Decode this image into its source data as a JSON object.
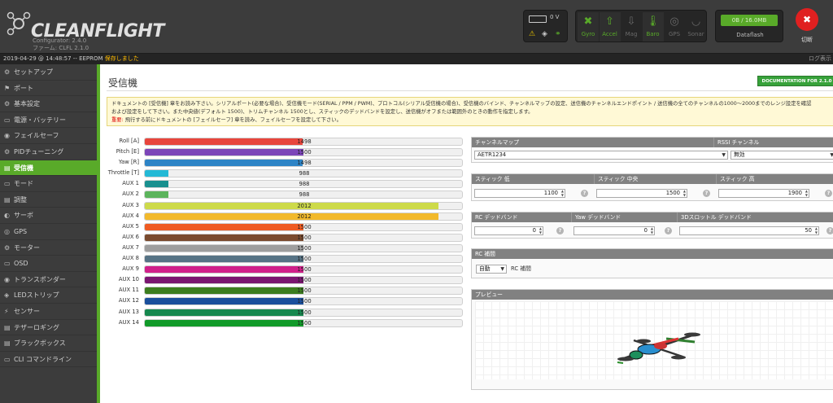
{
  "header": {
    "logo_text": "CLEANFLIGHT",
    "configurator_version": "Configurator: 2.4.0",
    "firmware_version": "ファーム: CLFL 2.1.0",
    "battery_voltage": "0 V",
    "sensors": [
      {
        "label": "Gyro",
        "icon": "gyro-icon",
        "glyph": "✖",
        "active": true
      },
      {
        "label": "Accel",
        "icon": "accel-icon",
        "glyph": "⇧",
        "active": true
      },
      {
        "label": "Mag",
        "icon": "mag-icon",
        "glyph": "⇩",
        "active": false
      },
      {
        "label": "Baro",
        "icon": "baro-icon",
        "glyph": "🌡",
        "active": true
      },
      {
        "label": "GPS",
        "icon": "gps-icon",
        "glyph": "◎",
        "active": false
      },
      {
        "label": "Sonar",
        "icon": "sonar-icon",
        "glyph": "◡",
        "active": false
      }
    ],
    "dataflash_usage": "0B / 16.0MB",
    "dataflash_label": "Dataflash",
    "disconnect_label": "切断",
    "accent_color": "#59aa29"
  },
  "log": {
    "text": "2019-04-29 @ 14:48:57 -- EEPROM ",
    "saved": "保存しました",
    "show_log": "ログ表示"
  },
  "sidebar": {
    "items": [
      {
        "label": "セットアップ",
        "icon": "wrench-icon",
        "glyph": "⚙"
      },
      {
        "label": "ポート",
        "icon": "port-icon",
        "glyph": "⚑"
      },
      {
        "label": "基本設定",
        "icon": "config-icon",
        "glyph": "⚙"
      },
      {
        "label": "電源・バッテリー",
        "icon": "battery-icon",
        "glyph": "▭"
      },
      {
        "label": "フェイルセーフ",
        "icon": "failsafe-icon",
        "glyph": "◉"
      },
      {
        "label": "PIDチューニング",
        "icon": "pid-icon",
        "glyph": "⚙"
      },
      {
        "label": "受信機",
        "icon": "receiver-icon",
        "glyph": "▤",
        "active": true
      },
      {
        "label": "モード",
        "icon": "modes-icon",
        "glyph": "▭"
      },
      {
        "label": "調整",
        "icon": "adjust-icon",
        "glyph": "▤"
      },
      {
        "label": "サーボ",
        "icon": "servo-icon",
        "glyph": "◐"
      },
      {
        "label": "GPS",
        "icon": "gps-nav-icon",
        "glyph": "◎"
      },
      {
        "label": "モーター",
        "icon": "motor-icon",
        "glyph": "⚙"
      },
      {
        "label": "OSD",
        "icon": "osd-icon",
        "glyph": "▭"
      },
      {
        "label": "トランスポンダー",
        "icon": "transponder-icon",
        "glyph": "◉"
      },
      {
        "label": "LEDストリップ",
        "icon": "led-icon",
        "glyph": "◈"
      },
      {
        "label": "センサー",
        "icon": "sensor-icon",
        "glyph": "⚡"
      },
      {
        "label": "テザーロギング",
        "icon": "logging-icon",
        "glyph": "▤"
      },
      {
        "label": "ブラックボックス",
        "icon": "blackbox-icon",
        "glyph": "▤"
      },
      {
        "label": "CLI コマンドライン",
        "icon": "cli-icon",
        "glyph": "▭"
      }
    ]
  },
  "main": {
    "title": "受信機",
    "doc_button": "DOCUMENTATION FOR 2.1.0",
    "note_line1": "ドキュメントの [受信機] 章をお読み下さい。シリアルポート(必要な場合)、受信機モード(SERIAL / PPM / PWM)、プロトコル(シリアル受信機の場合)、受信機のバインド、チャンネルマップの設定、送信機のチャンネルエンドポイント / 送信機の全てのチャンネルの1000～2000までのレンジ設定を確認",
    "note_line2": "および設定をして下さい。また中央値(デフォルト 1500)、トリムチャンネル 1500とし、スティックのデッドバンドを設定し、送信機がオフまたは範囲外のときの動作を指定します。",
    "note_warn_label": "重要:",
    "note_warn": " 飛行する前にドキュメントの [フェイルセーフ] 章を読み、フェイルセーフを設定して下さい。"
  },
  "channels": [
    {
      "name": "Roll [A]",
      "value": 1498,
      "color": "#e8453c"
    },
    {
      "name": "Pitch [E]",
      "value": 1500,
      "color": "#7c45b8"
    },
    {
      "name": "Yaw [R]",
      "value": 1498,
      "color": "#2e84c6"
    },
    {
      "name": "Throttle [T]",
      "value": 988,
      "color": "#24b9d6"
    },
    {
      "name": "AUX 1",
      "value": 988,
      "color": "#19908f"
    },
    {
      "name": "AUX 2",
      "value": 988,
      "color": "#5cb45c"
    },
    {
      "name": "AUX 3",
      "value": 2012,
      "color": "#cdda4a"
    },
    {
      "name": "AUX 4",
      "value": 2012,
      "color": "#f2b92c"
    },
    {
      "name": "AUX 5",
      "value": 1500,
      "color": "#ef5b22"
    },
    {
      "name": "AUX 6",
      "value": 1500,
      "color": "#7a4a2e"
    },
    {
      "name": "AUX 7",
      "value": 1500,
      "color": "#9e9e9e"
    },
    {
      "name": "AUX 8",
      "value": 1500,
      "color": "#567385"
    },
    {
      "name": "AUX 9",
      "value": 1500,
      "color": "#d0208a"
    },
    {
      "name": "AUX 10",
      "value": 1500,
      "color": "#7a1570"
    },
    {
      "name": "AUX 11",
      "value": 1500,
      "color": "#3c7d1e"
    },
    {
      "name": "AUX 12",
      "value": 1500,
      "color": "#1b4f9c"
    },
    {
      "name": "AUX 13",
      "value": 1500,
      "color": "#16884e"
    },
    {
      "name": "AUX 14",
      "value": 1500,
      "color": "#119a29"
    }
  ],
  "channel_range": [
    900,
    2100
  ],
  "settings": {
    "channel_map_label": "チャンネルマップ",
    "channel_map_value": "AETR1234",
    "rssi_label": "RSSI チャンネル",
    "rssi_value": "無効",
    "stick_min_label": "スティック 低",
    "stick_min_value": "1100",
    "stick_center_label": "スティック 中央",
    "stick_center_value": "1500",
    "stick_max_label": "スティック 高",
    "stick_max_value": "1900",
    "rc_deadband_label": "RC デッドバンド",
    "rc_deadband_value": "0",
    "yaw_deadband_label": "Yaw デッドバンド",
    "yaw_deadband_value": "0",
    "throttle_deadband_label": "3Dスロットル デッドバンド",
    "throttle_deadband_value": "50",
    "rc_interp_label": "RC 補間",
    "rc_interp_value": "自動",
    "rc_interp_caption": "RC 補間",
    "preview_label": "プレビュー",
    "help_glyph": "?"
  }
}
